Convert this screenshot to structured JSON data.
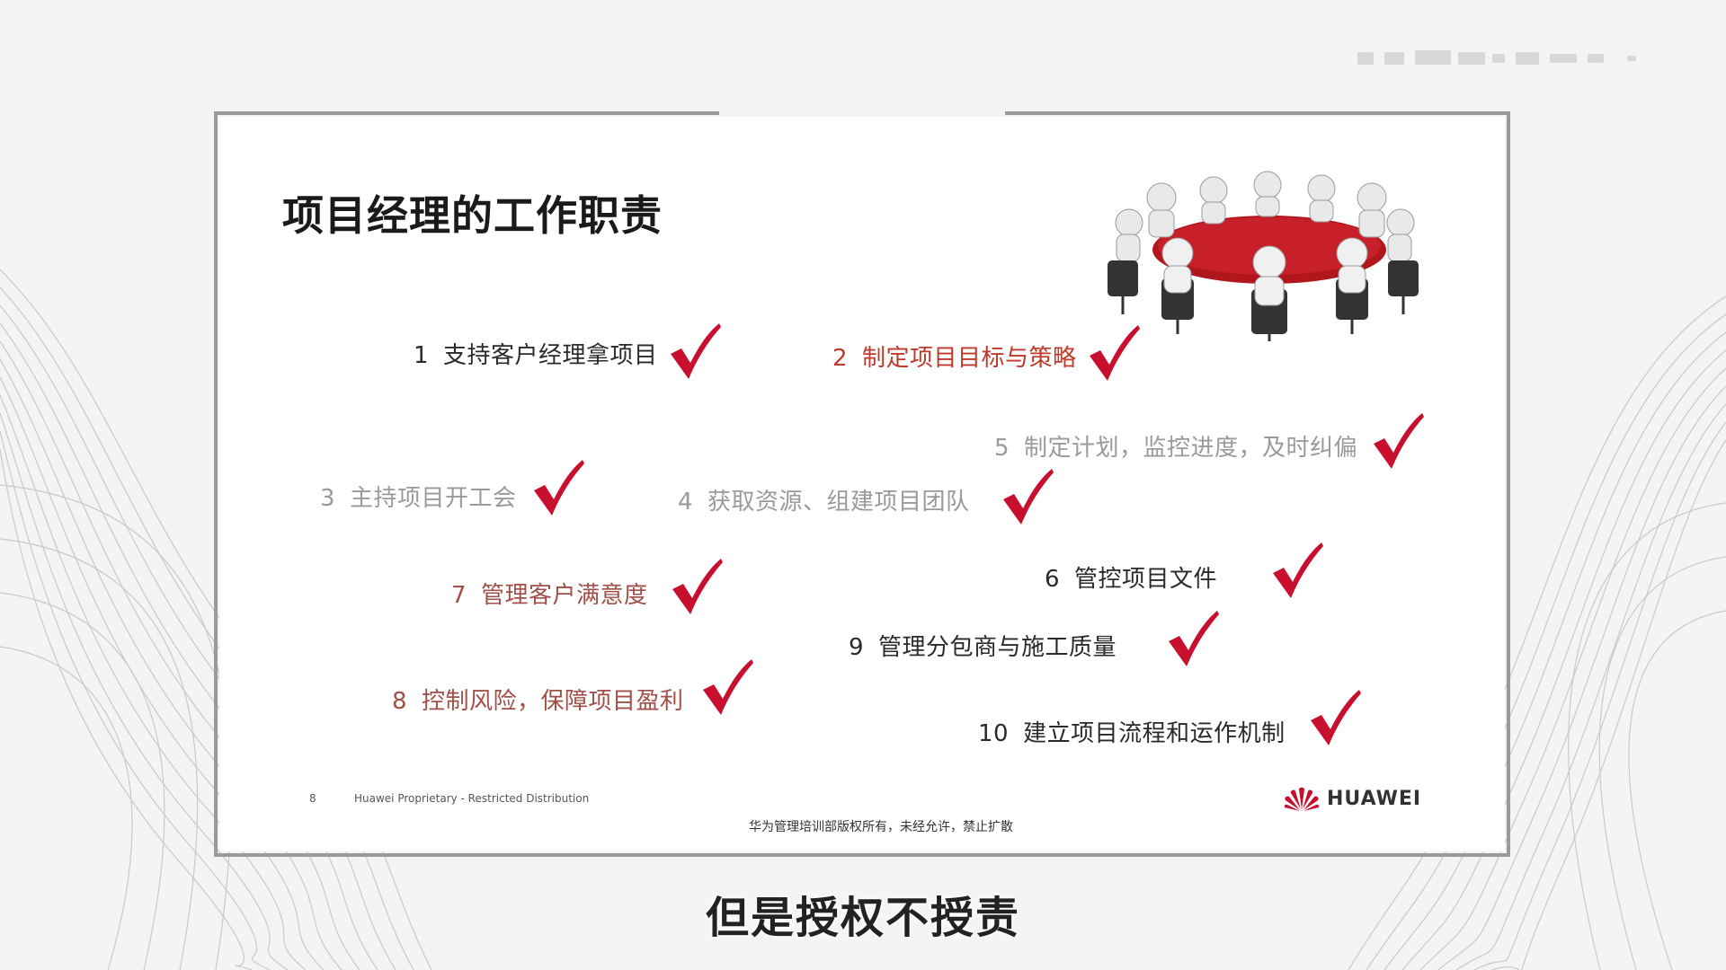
{
  "slide": {
    "title": "项目经理的工作职责",
    "duties": [
      {
        "num": "1",
        "text": "支持客户经理拿项目",
        "color": "#2a2a2a"
      },
      {
        "num": "2",
        "text": "制定项目目标与策略",
        "color": "#c0392b"
      },
      {
        "num": "5",
        "text": "制定计划，监控进度，及时纠偏",
        "color": "#9a9a9a"
      },
      {
        "num": "3",
        "text": "主持项目开工会",
        "color": "#9a9a9a"
      },
      {
        "num": "4",
        "text": "获取资源、组建项目团队",
        "color": "#9a9a9a"
      },
      {
        "num": "7",
        "text": "管理客户满意度",
        "color": "#a05048"
      },
      {
        "num": "6",
        "text": "管控项目文件",
        "color": "#2a2a2a"
      },
      {
        "num": "9",
        "text": "管理分包商与施工质量",
        "color": "#2a2a2a"
      },
      {
        "num": "8",
        "text": "控制风险，保障项目盈利",
        "color": "#a05048"
      },
      {
        "num": "10",
        "text": "建立项目流程和运作机制",
        "color": "#2a2a2a"
      }
    ],
    "check_color": "#c8102e",
    "footer": {
      "page": "8",
      "proprietary": "Huawei Proprietary - Restricted Distribution",
      "copyright": "华为管理培训部版权所有，未经允许，禁止扩散"
    },
    "logo": {
      "text": "HUAWEI",
      "color": "#c8102e"
    }
  },
  "subtitle": "但是授权不授责"
}
